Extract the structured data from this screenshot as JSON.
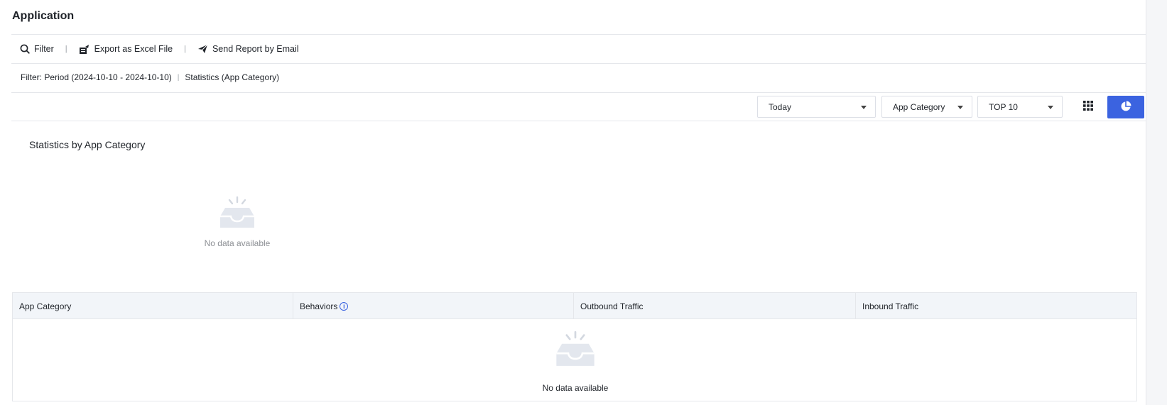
{
  "header": {
    "title": "Application"
  },
  "toolbar": {
    "filter_label": "Filter",
    "export_label": "Export as Excel File",
    "email_label": "Send Report by Email"
  },
  "filter_summary": {
    "period": "Filter: Period (2024-10-10 - 2024-10-10)",
    "statistics": "Statistics (App Category)"
  },
  "controls": {
    "period_select": "Today",
    "group_select": "App Category",
    "top_select": "TOP 10",
    "grid_view_icon": "grid-icon",
    "pie_view_icon": "pie-chart-icon",
    "active_color": "#3b63e0"
  },
  "chart_section": {
    "title": "Statistics by App Category",
    "empty_text": "No data available"
  },
  "table": {
    "columns": [
      "App Category",
      "Behaviors",
      "Outbound Traffic",
      "Inbound Traffic"
    ],
    "empty_text": "No data available"
  }
}
